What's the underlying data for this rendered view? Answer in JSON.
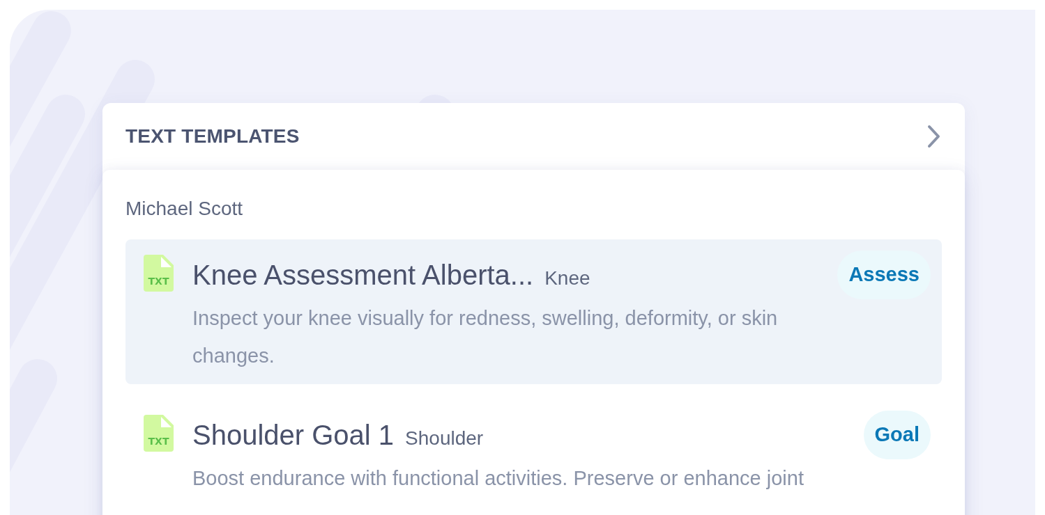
{
  "panel": {
    "title": "TEXT TEMPLATES"
  },
  "group": {
    "owner": "Michael Scott",
    "templates": [
      {
        "file_type": "TXT",
        "title": "Knee Assessment Alberta...",
        "body_part": "Knee",
        "tag": "Assess",
        "description": "Inspect your knee visually for redness, swelling, deformity, or skin changes.",
        "selected": true
      },
      {
        "file_type": "TXT",
        "title": "Shoulder Goal 1",
        "body_part": "Shoulder",
        "tag": "Goal",
        "description": "Boost endurance with functional activities. Preserve or enhance joint",
        "selected": false
      }
    ]
  }
}
